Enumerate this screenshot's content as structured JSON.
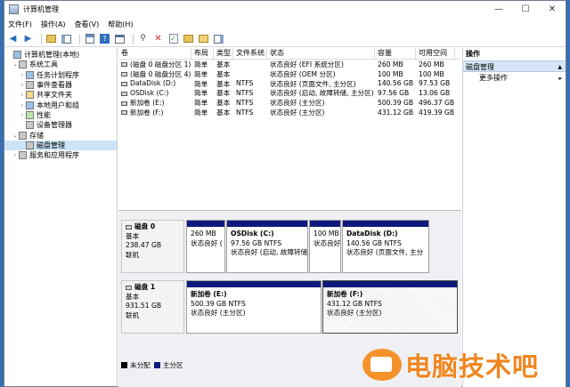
{
  "window": {
    "title": "计算机管理"
  },
  "controls": {
    "minimize": "—",
    "maximize": "☐",
    "close": "✕"
  },
  "menu": [
    "文件(F)",
    "操作(A)",
    "查看(V)",
    "帮助(H)"
  ],
  "tree": [
    {
      "label": "计算机管理(本地)",
      "indent": 0,
      "toggle": "",
      "icon": "computer-icon"
    },
    {
      "label": "系统工具",
      "indent": 1,
      "toggle": "⌄",
      "icon": "tools-icon"
    },
    {
      "label": "任务计划程序",
      "indent": 2,
      "toggle": "›",
      "icon": "task-scheduler-icon"
    },
    {
      "label": "事件查看器",
      "indent": 2,
      "toggle": "›",
      "icon": "event-viewer-icon"
    },
    {
      "label": "共享文件夹",
      "indent": 2,
      "toggle": "›",
      "icon": "shared-folder-icon"
    },
    {
      "label": "本地用户和组",
      "indent": 2,
      "toggle": "›",
      "icon": "users-icon"
    },
    {
      "label": "性能",
      "indent": 2,
      "toggle": "›",
      "icon": "performance-icon"
    },
    {
      "label": "设备管理器",
      "indent": 2,
      "toggle": "",
      "icon": "device-manager-icon"
    },
    {
      "label": "存储",
      "indent": 1,
      "toggle": "⌄",
      "icon": "storage-icon"
    },
    {
      "label": "磁盘管理",
      "indent": 2,
      "toggle": "",
      "icon": "disk-icon",
      "selected": true
    },
    {
      "label": "服务和应用程序",
      "indent": 1,
      "toggle": "›",
      "icon": "services-icon"
    }
  ],
  "volumes": {
    "headers": [
      "卷",
      "布局",
      "类型",
      "文件系统",
      "状态",
      "容量",
      "可用空间"
    ],
    "rows": [
      [
        "(磁盘 0 磁盘分区 1)",
        "简单",
        "基本",
        "",
        "状态良好 (EFI 系统分区)",
        "260 MB",
        "260 MB"
      ],
      [
        "(磁盘 0 磁盘分区 4)",
        "简单",
        "基本",
        "",
        "状态良好 (OEM 分区)",
        "100 MB",
        "100 MB"
      ],
      [
        "DataDisk (D:)",
        "简单",
        "基本",
        "NTFS",
        "状态良好 (页面文件, 主分区)",
        "140.56 GB",
        "97.53 GB"
      ],
      [
        "OSDisk (C:)",
        "简单",
        "基本",
        "NTFS",
        "状态良好 (启动, 故障转储, 主分区)",
        "97.56 GB",
        "13.06 GB"
      ],
      [
        "新加卷 (E:)",
        "简单",
        "基本",
        "NTFS",
        "状态良好 (主分区)",
        "500.39 GB",
        "496.37 GB"
      ],
      [
        "新加卷 (F:)",
        "简单",
        "基本",
        "NTFS",
        "状态良好 (主分区)",
        "431.12 GB",
        "419.39 GB"
      ]
    ]
  },
  "disks": [
    {
      "name": "磁盘 0",
      "type": "基本",
      "size": "238.47 GB",
      "status": "联机",
      "partitions": [
        {
          "name": "",
          "size": "260 MB",
          "status": "状态良好 ("
        },
        {
          "name": "OSDisk (C:)",
          "size": "97.56 GB NTFS",
          "status": "状态良好 (启动, 故障转储"
        },
        {
          "name": "",
          "size": "100 MB",
          "status": "状态良好"
        },
        {
          "name": "DataDisk (D:)",
          "size": "140.56 GB NTFS",
          "status": "状态良好 (页面文件, 主分"
        }
      ]
    },
    {
      "name": "磁盘 1",
      "type": "基本",
      "size": "931.51 GB",
      "status": "联机",
      "partitions": [
        {
          "name": "新加卷 (E:)",
          "size": "500.39 GB NTFS",
          "status": "状态良好 (主分区)"
        },
        {
          "name": "新加卷 (F:)",
          "size": "431.12 GB NTFS",
          "status": "状态良好 (主分区)"
        }
      ]
    }
  ],
  "legend": [
    {
      "label": "未分配",
      "color": "#000000"
    },
    {
      "label": "主分区",
      "color": "#0e1a7c"
    }
  ],
  "actions": {
    "title": "操作",
    "selected": "磁盘管理",
    "more": "更多操作",
    "selected_arrow": "▲",
    "more_arrow": "▸"
  },
  "watermark": {
    "text": "电脑技术吧"
  }
}
